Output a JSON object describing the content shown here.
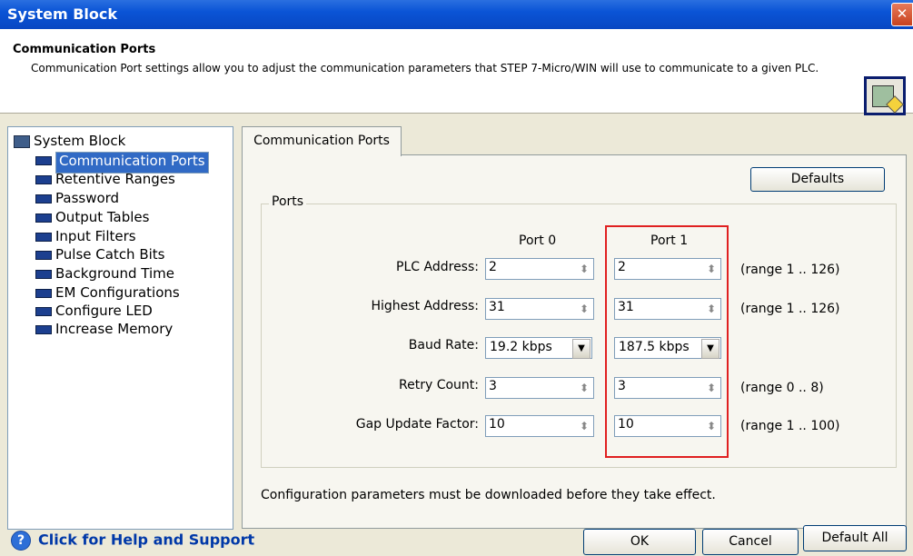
{
  "window": {
    "title": "System Block",
    "close_glyph": "✕"
  },
  "header": {
    "title": "Communication Ports",
    "description": "Communication Port settings allow you to adjust the communication parameters that STEP 7-Micro/WIN will use to communicate to a given PLC.",
    "icon": "plc-hand-icon"
  },
  "tree": {
    "root": "System Block",
    "items": [
      "Communication Ports",
      "Retentive Ranges",
      "Password",
      "Output Tables",
      "Input Filters",
      "Pulse Catch Bits",
      "Background Time",
      "EM Configurations",
      "Configure LED",
      "Increase Memory"
    ],
    "selected_index": 0
  },
  "tab": {
    "label": "Communication Ports"
  },
  "defaults_button": "Defaults",
  "ports": {
    "legend": "Ports",
    "port0_header": "Port 0",
    "port1_header": "Port 1",
    "rows": [
      {
        "label": "PLC Address:",
        "port0": "2",
        "port1": "2",
        "range": "(range 1 .. 126)"
      },
      {
        "label": "Highest Address:",
        "port0": "31",
        "port1": "31",
        "range": "(range 1 .. 126)"
      },
      {
        "label": "Baud Rate:",
        "port0": "19.2 kbps",
        "port1": "187.5 kbps",
        "range": ""
      },
      {
        "label": "Retry Count:",
        "port0": "3",
        "port1": "3",
        "range": "(range 0 .. 8)"
      },
      {
        "label": "Gap Update Factor:",
        "port0": "10",
        "port1": "10",
        "range": "(range 1 .. 100)"
      }
    ]
  },
  "note": "Configuration parameters must be downloaded before they take effect.",
  "footer": {
    "help_label": "Click for Help and Support",
    "help_glyph": "?",
    "ok": "OK",
    "cancel": "Cancel",
    "default_all": "Default All"
  },
  "colors": {
    "title_bar": "#0a54d6",
    "selection": "#316ac5",
    "highlight_box": "#e02020",
    "help_link": "#0038a8"
  }
}
